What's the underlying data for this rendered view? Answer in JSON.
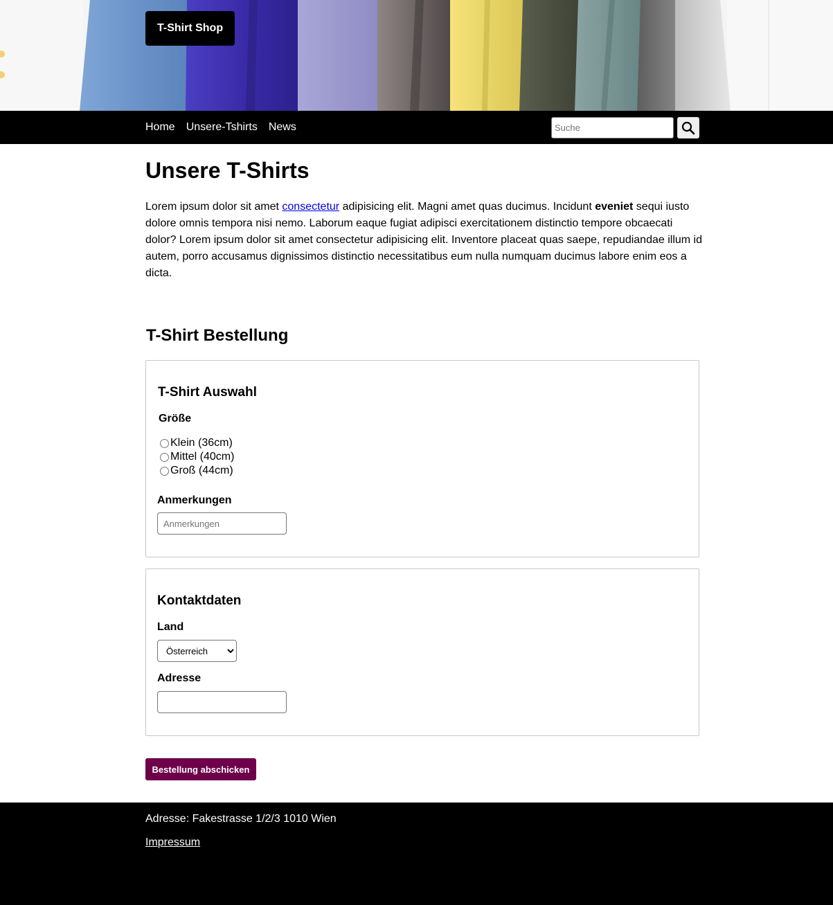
{
  "header": {
    "logo": "T-Shirt Shop"
  },
  "nav": {
    "links": [
      "Home",
      "Unsere-Tshirts",
      "News"
    ],
    "search_placeholder": "Suche"
  },
  "main": {
    "title": "Unsere T-Shirts",
    "intro": {
      "part1": "Lorem ipsum dolor sit amet ",
      "link": "consectetur",
      "part2": " adipisicing elit. Magni amet quas ducimus. Incidunt ",
      "bold": "eveniet",
      "part3": " sequi iusto dolore omnis tempora nisi nemo. Laborum eaque fugiat adipisci exercitationem distinctio tempore obcaecati dolor? Lorem ipsum dolor sit amet consectetur adipisicing elit. Inventore placeat quas saepe, repudiandae illum id autem, porro accusamus dignissimos distinctio necessitatibus eum nulla numquam ducimus labore enim eos a dicta."
    }
  },
  "order": {
    "title": "T-Shirt Bestellung",
    "selection": {
      "legend": "T-Shirt Auswahl",
      "size_label": "Größe",
      "sizes": [
        "Klein (36cm)",
        "Mittel (40cm)",
        "Groß (44cm)"
      ],
      "notes_label": "Anmerkungen",
      "notes_placeholder": "Anmerkungen"
    },
    "contact": {
      "legend": "Kontaktdaten",
      "country_label": "Land",
      "country_selected": "Österreich",
      "address_label": "Adresse",
      "address_value": ""
    },
    "submit_label": "Bestellung abschicken"
  },
  "footer": {
    "address": "Adresse: Fakestrasse 1/2/3 1010 Wien",
    "impressum": "Impressum"
  },
  "colors": {
    "nav_bg": "#000000",
    "submit_bg": "#6e004a",
    "link": "#0000ee"
  }
}
